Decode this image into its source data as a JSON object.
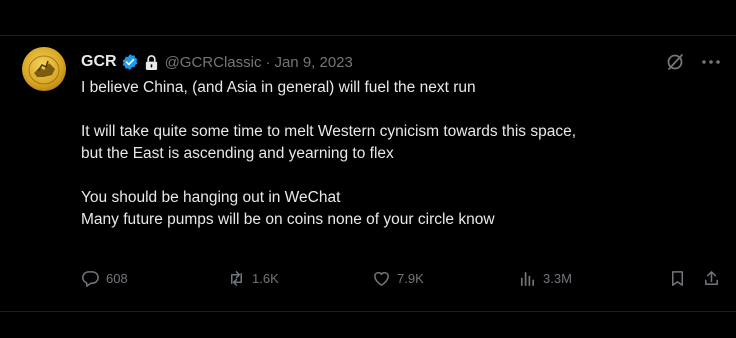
{
  "tweet": {
    "display_name": "GCR",
    "handle": "@GCRClassic",
    "separator": "·",
    "date": "Jan 9, 2023",
    "lines": [
      "I believe China, (and Asia in general) will fuel the next run",
      "",
      "It will take quite some time to melt Western cynicism towards this space,",
      "but the East is ascending and yearning to flex",
      "",
      "You should be hanging out in WeChat",
      "Many future pumps will be on coins none of your circle know"
    ]
  },
  "actions": {
    "replies": "608",
    "reposts": "1.6K",
    "likes": "7.9K",
    "views": "3.3M"
  },
  "icons": {
    "verified": "verified-badge-icon",
    "lock": "lock-icon",
    "grok": "grok-icon",
    "more": "more-icon",
    "reply": "reply-icon",
    "repost": "repost-icon",
    "like": "heart-icon",
    "views": "views-icon",
    "bookmark": "bookmark-icon",
    "share": "share-icon"
  },
  "colors": {
    "background": "#000000",
    "text": "#e7e9ea",
    "muted": "#71767b",
    "verified_blue": "#1d9bf0",
    "avatar_gold": "#d9a521"
  }
}
